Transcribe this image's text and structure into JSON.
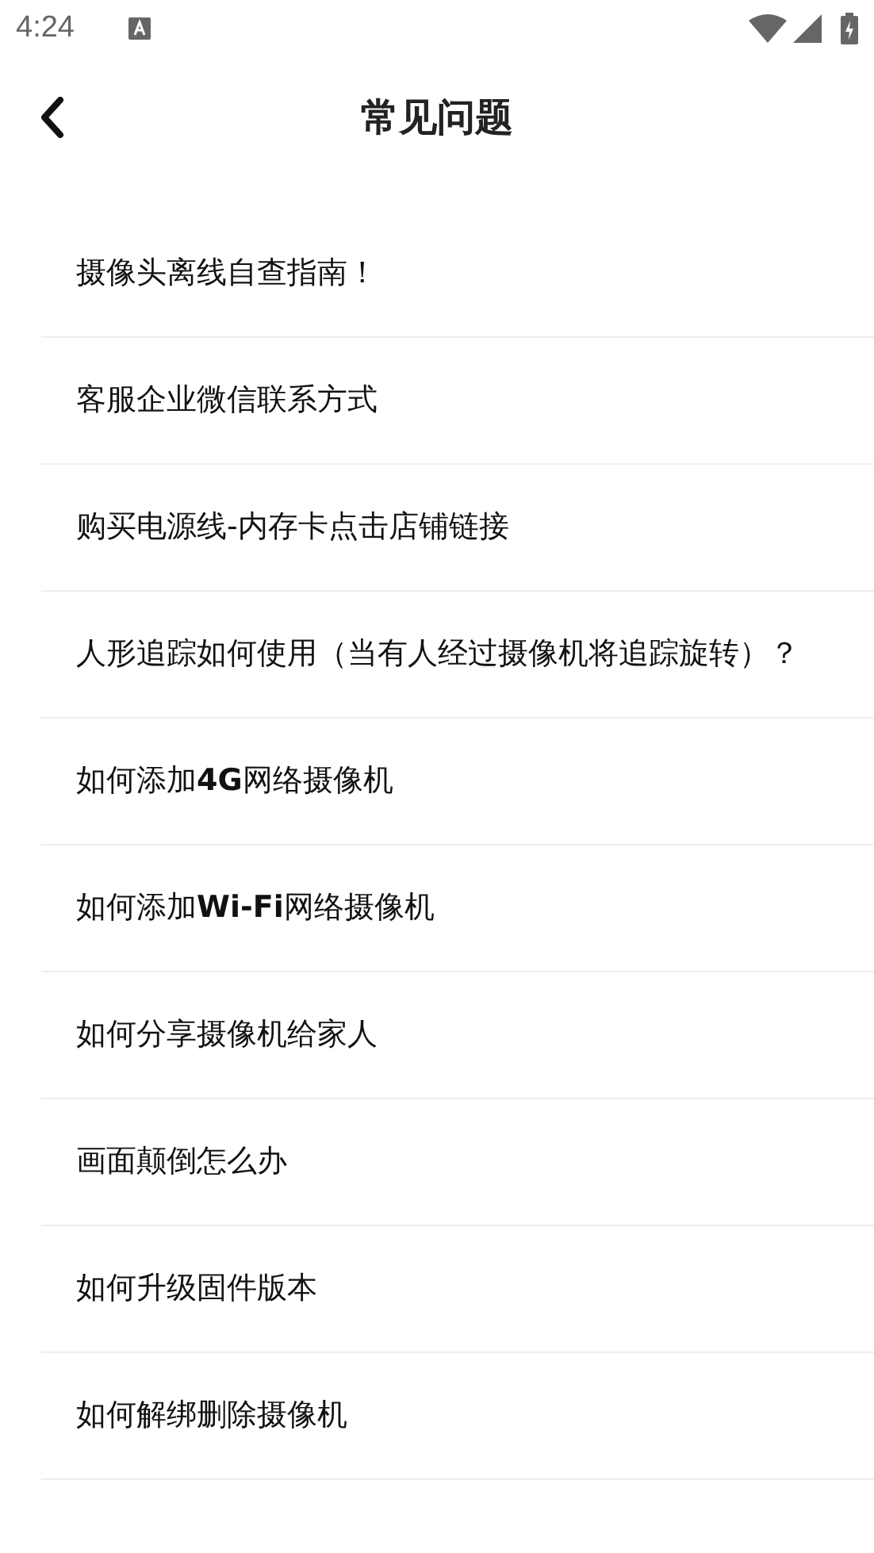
{
  "status_bar": {
    "time": "4:24"
  },
  "header": {
    "title": "常见问题"
  },
  "faq_items": [
    {
      "text": "摄像头离线自查指南！"
    },
    {
      "text": "客服企业微信联系方式"
    },
    {
      "text": "购买电源线-内存卡点击店铺链接"
    },
    {
      "text": "人形追踪如何使用（当有人经过摄像机将追踪旋转）？"
    },
    {
      "text": "如何添加**4G**网络摄像机"
    },
    {
      "text": "如何添加**Wi-Fi**网络摄像机"
    },
    {
      "text": "如何分享摄像机给家人"
    },
    {
      "text": "画面颠倒怎么办"
    },
    {
      "text": "如何升级固件版本"
    },
    {
      "text": "如何解绑删除摄像机"
    }
  ]
}
